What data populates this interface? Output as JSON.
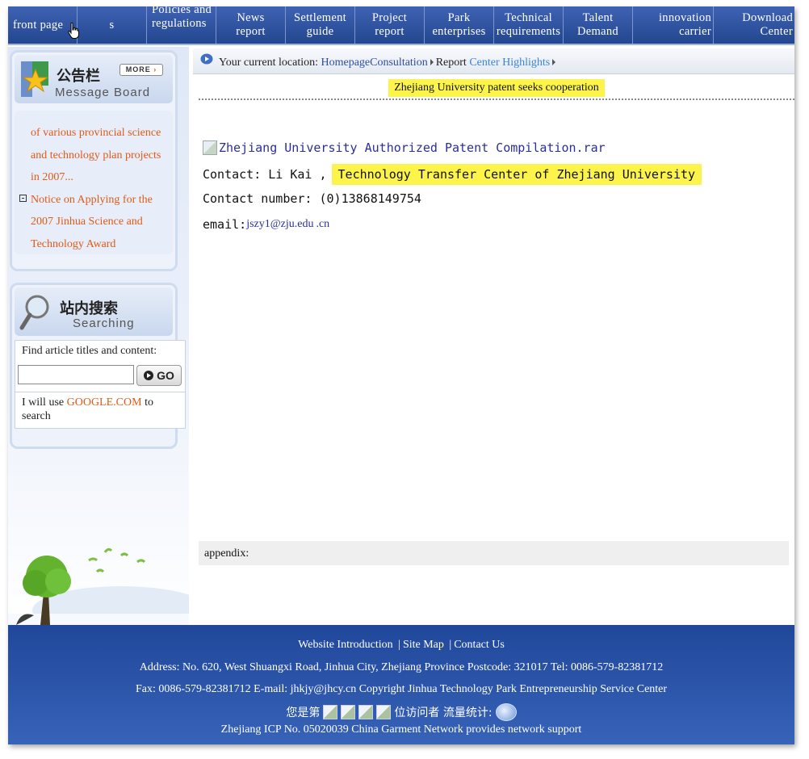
{
  "nav": {
    "items": [
      {
        "label": "front page"
      },
      {
        "label": "s"
      },
      {
        "label": "Policies and regulations"
      },
      {
        "label": "News report"
      },
      {
        "label": "Settlement guide"
      },
      {
        "label": "Project report"
      },
      {
        "label": "Park enterprises"
      },
      {
        "label": "Technical requirements"
      },
      {
        "label": "Talent Demand"
      },
      {
        "label": "innovation carrier"
      },
      {
        "label": "Download Center"
      }
    ]
  },
  "sidebar": {
    "board": {
      "title_cn": "公告栏",
      "title_en": "Message Board",
      "more_label": "MORE",
      "items": [
        {
          "text": "of various provincial science and technology plan projects in 2007...",
          "bullet": false
        },
        {
          "text": "Notice on Applying for the 2007 Jinhua Science and Technology Award",
          "bullet": true
        }
      ]
    },
    "search": {
      "title_cn": "站内搜索",
      "title_en": "Searching",
      "label": "Find article titles and content:",
      "input_value": "",
      "go_label": "GO",
      "google_prefix": "I will use ",
      "google_link": "GOOGLE.COM",
      "google_suffix": " to search"
    }
  },
  "breadcrumb": {
    "prefix": "Your current location: ",
    "home": "HomepageConsultation",
    "report": "Report",
    "highlights": "Center Highlights"
  },
  "article": {
    "title": "Zhejiang University patent seeks cooperation",
    "attachment_alt": "Zhejiang University Authorized Patent Compilation.rar",
    "contact_prefix": "Contact: Li Kai ,",
    "contact_org": "Technology Transfer Center of Zhejiang University",
    "phone_line": "Contact number: (0)13868149754",
    "email_prefix": "email:",
    "email_link": "jszy1@zju.edu",
    "email_suffix": ".cn",
    "appendix_label": "appendix:"
  },
  "footer": {
    "links": [
      "Website Introduction",
      "Site Map",
      "Contact Us"
    ],
    "separator": "|",
    "address": "Address: No. 620, West Shuangxi Road, Jinhua City, Zhejiang Province Postcode: 321017 Tel: 0086-579-82381712",
    "fax": "Fax: 0086-579-82381712 E-mail: jhkjy@jhcy.cn Copyright Jinhua Technology Park Entrepreneurship Service Center",
    "visitor_prefix": "您是第",
    "visitor_suffix": "位访问者 流量统计:",
    "icp": "Zhejiang ICP No. 05020039 China Garment Network provides network support"
  },
  "colors": {
    "nav_bg": "#2f54a3",
    "accent_orange": "#e15a16",
    "link_blue": "#2b4fa5",
    "highlight_yellow": "#fcf44a",
    "footer_bg": "#2b55a8"
  }
}
